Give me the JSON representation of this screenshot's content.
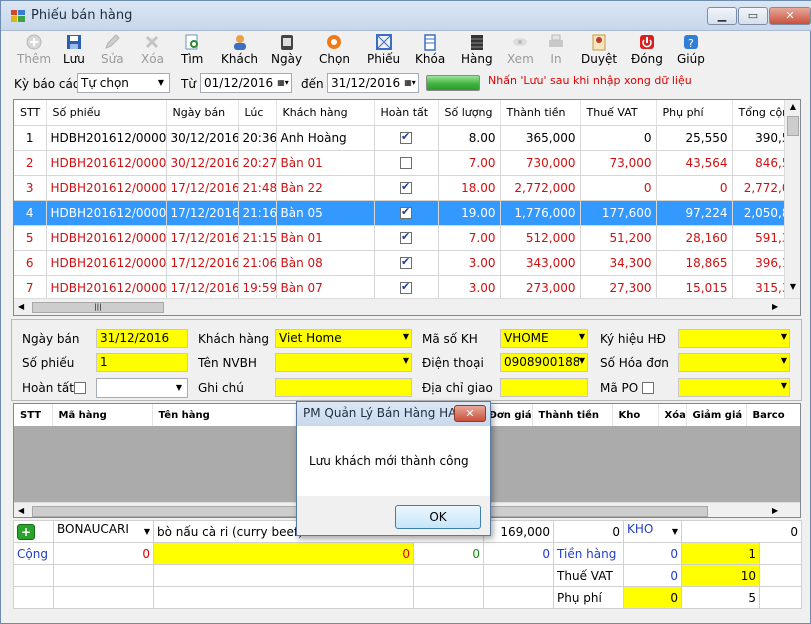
{
  "window": {
    "title": "Phiếu bán hàng"
  },
  "toolbar": [
    {
      "label": "Thêm",
      "icon": "plus-icon",
      "enabled": false
    },
    {
      "label": "Lưu",
      "icon": "save-icon",
      "enabled": true
    },
    {
      "label": "Sửa",
      "icon": "pencil-icon",
      "enabled": false
    },
    {
      "label": "Xóa",
      "icon": "delete-icon",
      "enabled": false
    },
    {
      "label": "Tìm",
      "icon": "search-icon",
      "enabled": true
    },
    {
      "label": "Khách",
      "icon": "customer-icon",
      "enabled": true
    },
    {
      "label": "Ngày",
      "icon": "calendar-icon",
      "enabled": true
    },
    {
      "label": "Chọn",
      "icon": "gear-icon",
      "enabled": true
    },
    {
      "label": "Phiếu",
      "icon": "voucher-icon",
      "enabled": true
    },
    {
      "label": "Khóa",
      "icon": "lock-icon",
      "enabled": true
    },
    {
      "label": "Hàng",
      "icon": "goods-icon",
      "enabled": true
    },
    {
      "label": "Xem",
      "icon": "view-icon",
      "enabled": false
    },
    {
      "label": "In",
      "icon": "print-icon",
      "enabled": false
    },
    {
      "label": "Duyệt",
      "icon": "approve-icon",
      "enabled": true
    },
    {
      "label": "Đóng",
      "icon": "power-icon",
      "enabled": true
    },
    {
      "label": "Giúp",
      "icon": "help-icon",
      "enabled": true
    }
  ],
  "filter": {
    "period_label": "Kỳ báo cáo",
    "period_value": "Tự chọn",
    "from_label": "Từ",
    "from_date": "01/12/2016",
    "to_label": "đến",
    "to_date": "31/12/2016",
    "hint": "Nhấn 'Lưu' sau khi nhập xong dữ liệu"
  },
  "invoice_grid": {
    "columns": [
      "STT",
      "Số phiếu",
      "Ngày bán",
      "Lúc",
      "Khách hàng",
      "Hoàn tất",
      "Số lượng",
      "Thành tiền",
      "Thuế VAT",
      "Phụ phí",
      "Tổng cộng"
    ],
    "rows": [
      {
        "stt": "1",
        "so_phieu": "HDBH201612/0000",
        "ngay": "30/12/2016",
        "luc": "20:36",
        "khach": "Anh Hoàng",
        "done": true,
        "sl": "8.00",
        "tien": "365,000",
        "vat": "0",
        "phu": "25,550",
        "tong": "390,5",
        "style": "normal"
      },
      {
        "stt": "2",
        "so_phieu": "HDBH201612/0000",
        "ngay": "30/12/2016",
        "luc": "20:27",
        "khach": "Bàn 01",
        "done": false,
        "sl": "7.00",
        "tien": "730,000",
        "vat": "73,000",
        "phu": "43,564",
        "tong": "846,5",
        "style": "red"
      },
      {
        "stt": "3",
        "so_phieu": "HDBH201612/0000",
        "ngay": "17/12/2016",
        "luc": "21:48",
        "khach": "Bàn 22",
        "done": true,
        "sl": "18.00",
        "tien": "2,772,000",
        "vat": "0",
        "phu": "0",
        "tong": "2,772,0",
        "style": "red"
      },
      {
        "stt": "4",
        "so_phieu": "HDBH201612/0000",
        "ngay": "17/12/2016",
        "luc": "21:16",
        "khach": "Bàn 05",
        "done": true,
        "sl": "19.00",
        "tien": "1,776,000",
        "vat": "177,600",
        "phu": "97,224",
        "tong": "2,050,8",
        "style": "sel"
      },
      {
        "stt": "5",
        "so_phieu": "HDBH201612/0000",
        "ngay": "17/12/2016",
        "luc": "21:15",
        "khach": "Bàn 01",
        "done": true,
        "sl": "7.00",
        "tien": "512,000",
        "vat": "51,200",
        "phu": "28,160",
        "tong": "591,3",
        "style": "red"
      },
      {
        "stt": "6",
        "so_phieu": "HDBH201612/0000",
        "ngay": "17/12/2016",
        "luc": "21:06",
        "khach": "Bàn 08",
        "done": true,
        "sl": "3.00",
        "tien": "343,000",
        "vat": "34,300",
        "phu": "18,865",
        "tong": "396,1",
        "style": "red"
      },
      {
        "stt": "7",
        "so_phieu": "HDBH201612/0000",
        "ngay": "17/12/2016",
        "luc": "19:59",
        "khach": "Bàn 07",
        "done": true,
        "sl": "3.00",
        "tien": "273,000",
        "vat": "27,300",
        "phu": "15,015",
        "tong": "315,3",
        "style": "red"
      }
    ]
  },
  "form": {
    "ngay_ban_label": "Ngày bán",
    "ngay_ban": "31/12/2016",
    "so_phieu_label": "Số phiếu",
    "so_phieu": "1",
    "hoan_tat_label": "Hoàn tất",
    "khach_hang_label": "Khách hàng",
    "khach_hang": "Viet Home",
    "nvbh_label": "Tên NVBH",
    "ghi_chu_label": "Ghi chú",
    "ma_kh_label": "Mã số KH",
    "ma_kh": "VHOME",
    "dien_thoai_label": "Điện thoại",
    "dien_thoai": "0908900188",
    "dia_chi_label": "Địa chỉ giao",
    "ky_hieu_label": "Ký hiệu HĐ",
    "so_hd_label": "Số Hóa đơn",
    "ma_po_label": "Mã PO"
  },
  "detail_grid": {
    "columns": [
      "STT",
      "Mã hàng",
      "Tên hàng",
      "Đơn giá",
      "Thành tiền",
      "Kho",
      "Xóa",
      "Giảm giá",
      "Barco"
    ]
  },
  "entry_row": {
    "ma_hang": "BONAUCARI",
    "ten_hang": "bò nấu cà ri (curry beef)",
    "don_gia": "169,000",
    "thanh_tien": "0",
    "kho": "KHO",
    "giam_gia": "0"
  },
  "totals": {
    "cong_label": "Cộng",
    "cong_sl": "0",
    "cong_tien": "0",
    "cong_a": "0",
    "cong_b": "0",
    "tien_hang_label": "Tiền hàng",
    "tien_hang": "0",
    "tien_hang_pct": "1",
    "vat_label": "Thuế VAT",
    "vat": "0",
    "vat_pct": "10",
    "phu_phi_label": "Phụ phí",
    "phu_phi": "0",
    "phu_phi_pct": "5"
  },
  "dialog": {
    "title": "PM Quản Lý Bán Hàng HAS",
    "message": "Lưu khách mới thành công",
    "ok": "OK"
  }
}
